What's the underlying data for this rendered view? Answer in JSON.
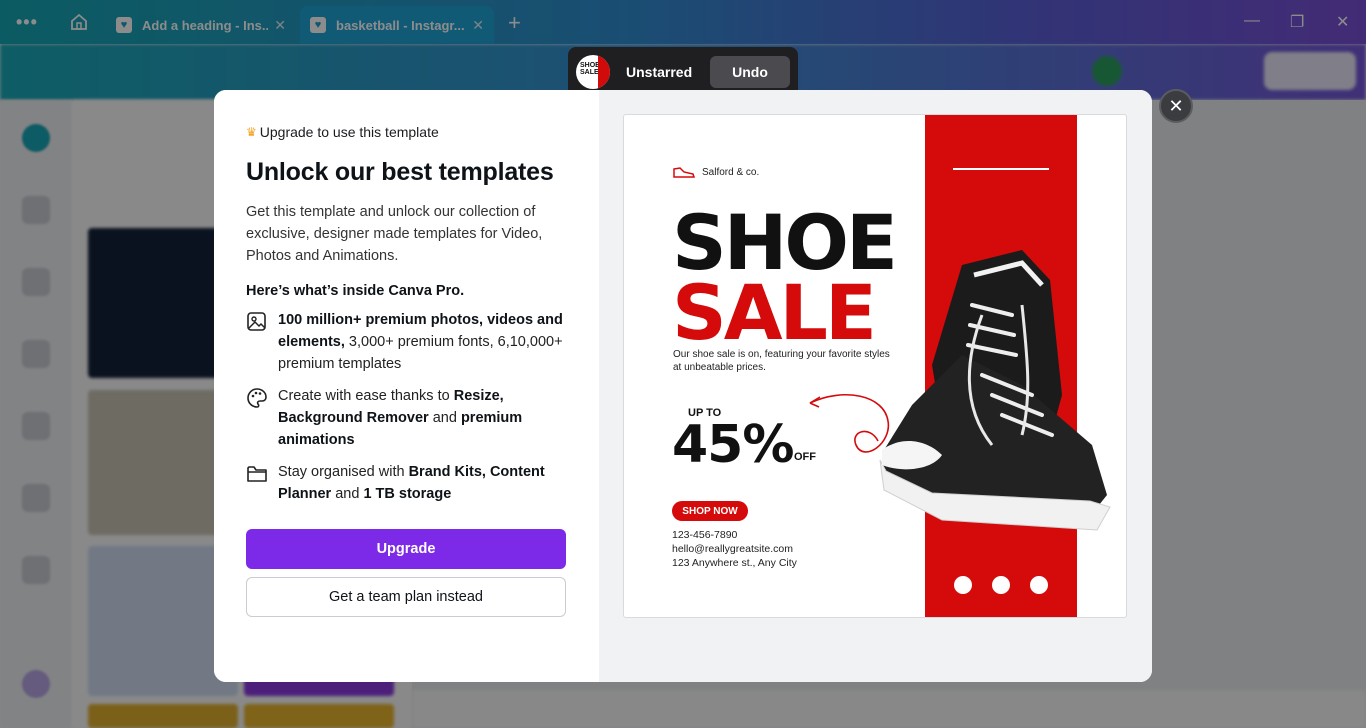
{
  "browser": {
    "tabs": [
      {
        "title": "Add a heading - Ins..."
      },
      {
        "title": "basketball - Instagr..."
      }
    ]
  },
  "toast": {
    "message": "Unstarred",
    "undo_label": "Undo"
  },
  "modal": {
    "eyebrow": "Upgrade to use this template",
    "headline": "Unlock our best templates",
    "description": "Get this template and unlock our collection of exclusive, designer made templates for Video, Photos and Animations.",
    "inside_title": "Here’s what’s inside Canva Pro.",
    "features": [
      {
        "icon": "image-icon",
        "bold1": "100 million+ premium photos, videos and elements,",
        "text1": " 3,000+ premium fonts, 6,10,000+ premium templates"
      },
      {
        "icon": "palette-icon",
        "text1": "Create with ease thanks to ",
        "bold1": "Resize, Background Remover",
        "text2": " and ",
        "bold2": "premium animations"
      },
      {
        "icon": "folder-icon",
        "text1": "Stay organised with ",
        "bold1": "Brand Kits, Content Planner",
        "text2": " and ",
        "bold2": "1 TB storage"
      }
    ],
    "upgrade_label": "Upgrade",
    "team_label": "Get a team plan instead"
  },
  "template": {
    "brand": "Salford & co.",
    "line1": "SHOE",
    "line2": "SALE",
    "subtitle": "Our shoe sale is on, featuring your favorite styles at unbeatable prices.",
    "up_to": "UP TO",
    "percent": "45%",
    "off": "OFF",
    "shop_now": "SHOP NOW",
    "phone": "123-456-7890",
    "email": "hello@reallygreatsite.com",
    "address": "123 Anywhere st., Any City"
  },
  "colors": {
    "accent_purple": "#7d2ae8",
    "template_red": "#d50a0a",
    "crown": "#f4a01c"
  }
}
